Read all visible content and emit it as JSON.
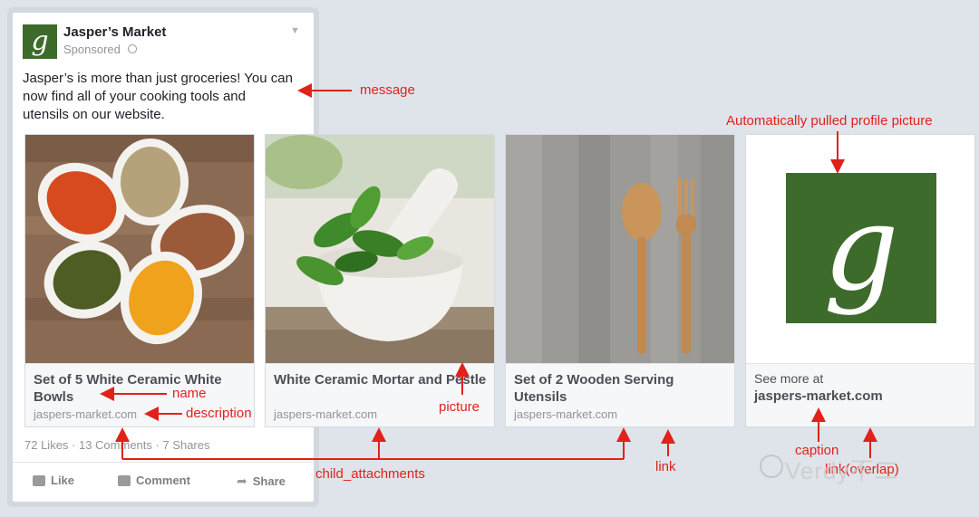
{
  "post": {
    "page_name": "Jasper’s Market",
    "logo_letter": "g",
    "sponsored": "Sponsored",
    "message": "Jasper’s is more than just groceries! You can now find all of your cooking tools and utensils on our website.",
    "social_counts": "72 Likes · 13 Comments · 7 Shares",
    "actions": {
      "like": "Like",
      "comment": "Comment",
      "share": "Share"
    }
  },
  "cards": [
    {
      "title": "Set of 5 White Ceramic White Bowls",
      "domain": "jaspers-market.com",
      "image": "spice-bowls"
    },
    {
      "title": "White Ceramic Mortar and Pestle",
      "domain": "jaspers-market.com",
      "image": "mortar-pestle"
    },
    {
      "title": "Set of 2 Wooden Serving Utensils",
      "domain": "jaspers-market.com",
      "image": "wooden-utensils"
    },
    {
      "see_more": "See more at",
      "domain": "jaspers-market.com",
      "image": "profile-logo",
      "logo_letter": "g"
    }
  ],
  "annotations": {
    "message": "message",
    "profile": "Automatically pulled profile picture",
    "name": "name",
    "description": "description",
    "picture": "picture",
    "child_attachments": "child_attachments",
    "link": "link",
    "caption": "caption",
    "link_overlap": "link(overlap)"
  },
  "watermark": "Verdy不二",
  "colors": {
    "annotation": "#e0221b",
    "brand_green": "#3d6b2b"
  }
}
